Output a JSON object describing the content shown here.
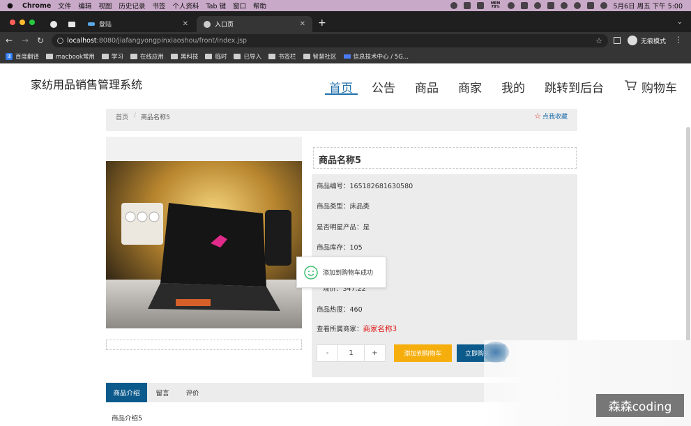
{
  "menubar": {
    "app": "Chrome",
    "items": [
      "文件",
      "编辑",
      "视图",
      "历史记录",
      "书签",
      "个人资料",
      "Tab 键",
      "窗口",
      "帮助"
    ],
    "mem_label": "MEM",
    "mem_value": "78%",
    "clock": "5月6日 周五 下午 5:00"
  },
  "tabs": [
    {
      "title": "登陆"
    },
    {
      "title": "入口页"
    }
  ],
  "address": {
    "host": "localhost",
    "path": ":8080/jiafangyongpinxiaoshou/front/index.jsp"
  },
  "incognito_label": "无痕模式",
  "bookmarks": [
    "百度翻译",
    "macbook常用",
    "学习",
    "在线应用",
    "黑科技",
    "临时",
    "已导入",
    "书签栏",
    "智慧社区",
    "信息技术中心 / 5G..."
  ],
  "site": {
    "title": "家纺用品销售管理系统",
    "nav": [
      "首页",
      "公告",
      "商品",
      "商家",
      "我的",
      "跳转到后台",
      "购物车"
    ]
  },
  "breadcrumb": {
    "home": "首页",
    "separator": "/",
    "current": "商品名称5",
    "favorite": "点我收藏"
  },
  "product": {
    "name": "商品名称5",
    "rows": [
      {
        "label": "商品编号：",
        "value": "165182681630580"
      },
      {
        "label": "商品类型：",
        "value": "床品类"
      },
      {
        "label": "是否明星产品：",
        "value": "是"
      },
      {
        "label": "商品库存：",
        "value": "105"
      },
      {
        "label": "现价：",
        "value": "347.22"
      },
      {
        "label": "商品热度：",
        "value": "460"
      }
    ],
    "shop_label": "查看所属商家：",
    "shop_name": "商家名称3",
    "quantity": "1",
    "minus": "-",
    "plus": "+",
    "add_cart": "添加到购物车",
    "buy_now": "立即购买"
  },
  "toast": "添加到购物车成功",
  "detail_tabs": [
    "商品介绍",
    "留言",
    "评价"
  ],
  "description": "商品介绍5",
  "watermark": "森森coding",
  "colors": {
    "primary": "#0c5a8b",
    "accent": "#f6ae0d",
    "shop_link": "#e01818"
  }
}
